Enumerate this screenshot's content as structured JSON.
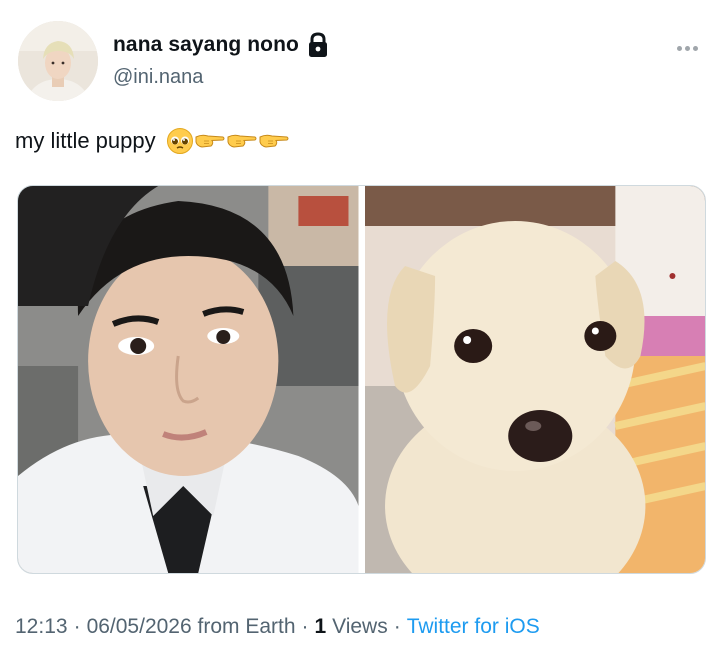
{
  "author": {
    "display_name": "nana sayang nono",
    "handle": "@ini.nana",
    "protected_icon": "lock-icon"
  },
  "tweet": {
    "text": "my little puppy",
    "emojis": [
      "pleading-face-emoji",
      "backhand-index-pointing-right-emoji",
      "backhand-index-pointing-right-emoji",
      "backhand-index-pointing-right-emoji"
    ]
  },
  "media": {
    "photos": [
      "selfie-photo",
      "puppy-photo"
    ]
  },
  "meta": {
    "time": "12:13",
    "sep1": "·",
    "date": "06/05/2026 from Earth",
    "sep2": "·",
    "view_count": "1",
    "views_label": "Views",
    "sep3": "·",
    "source": "Twitter for iOS"
  },
  "colors": {
    "link": "#1d9bf0",
    "secondary_text": "#536471",
    "primary_text": "#0f1419"
  }
}
